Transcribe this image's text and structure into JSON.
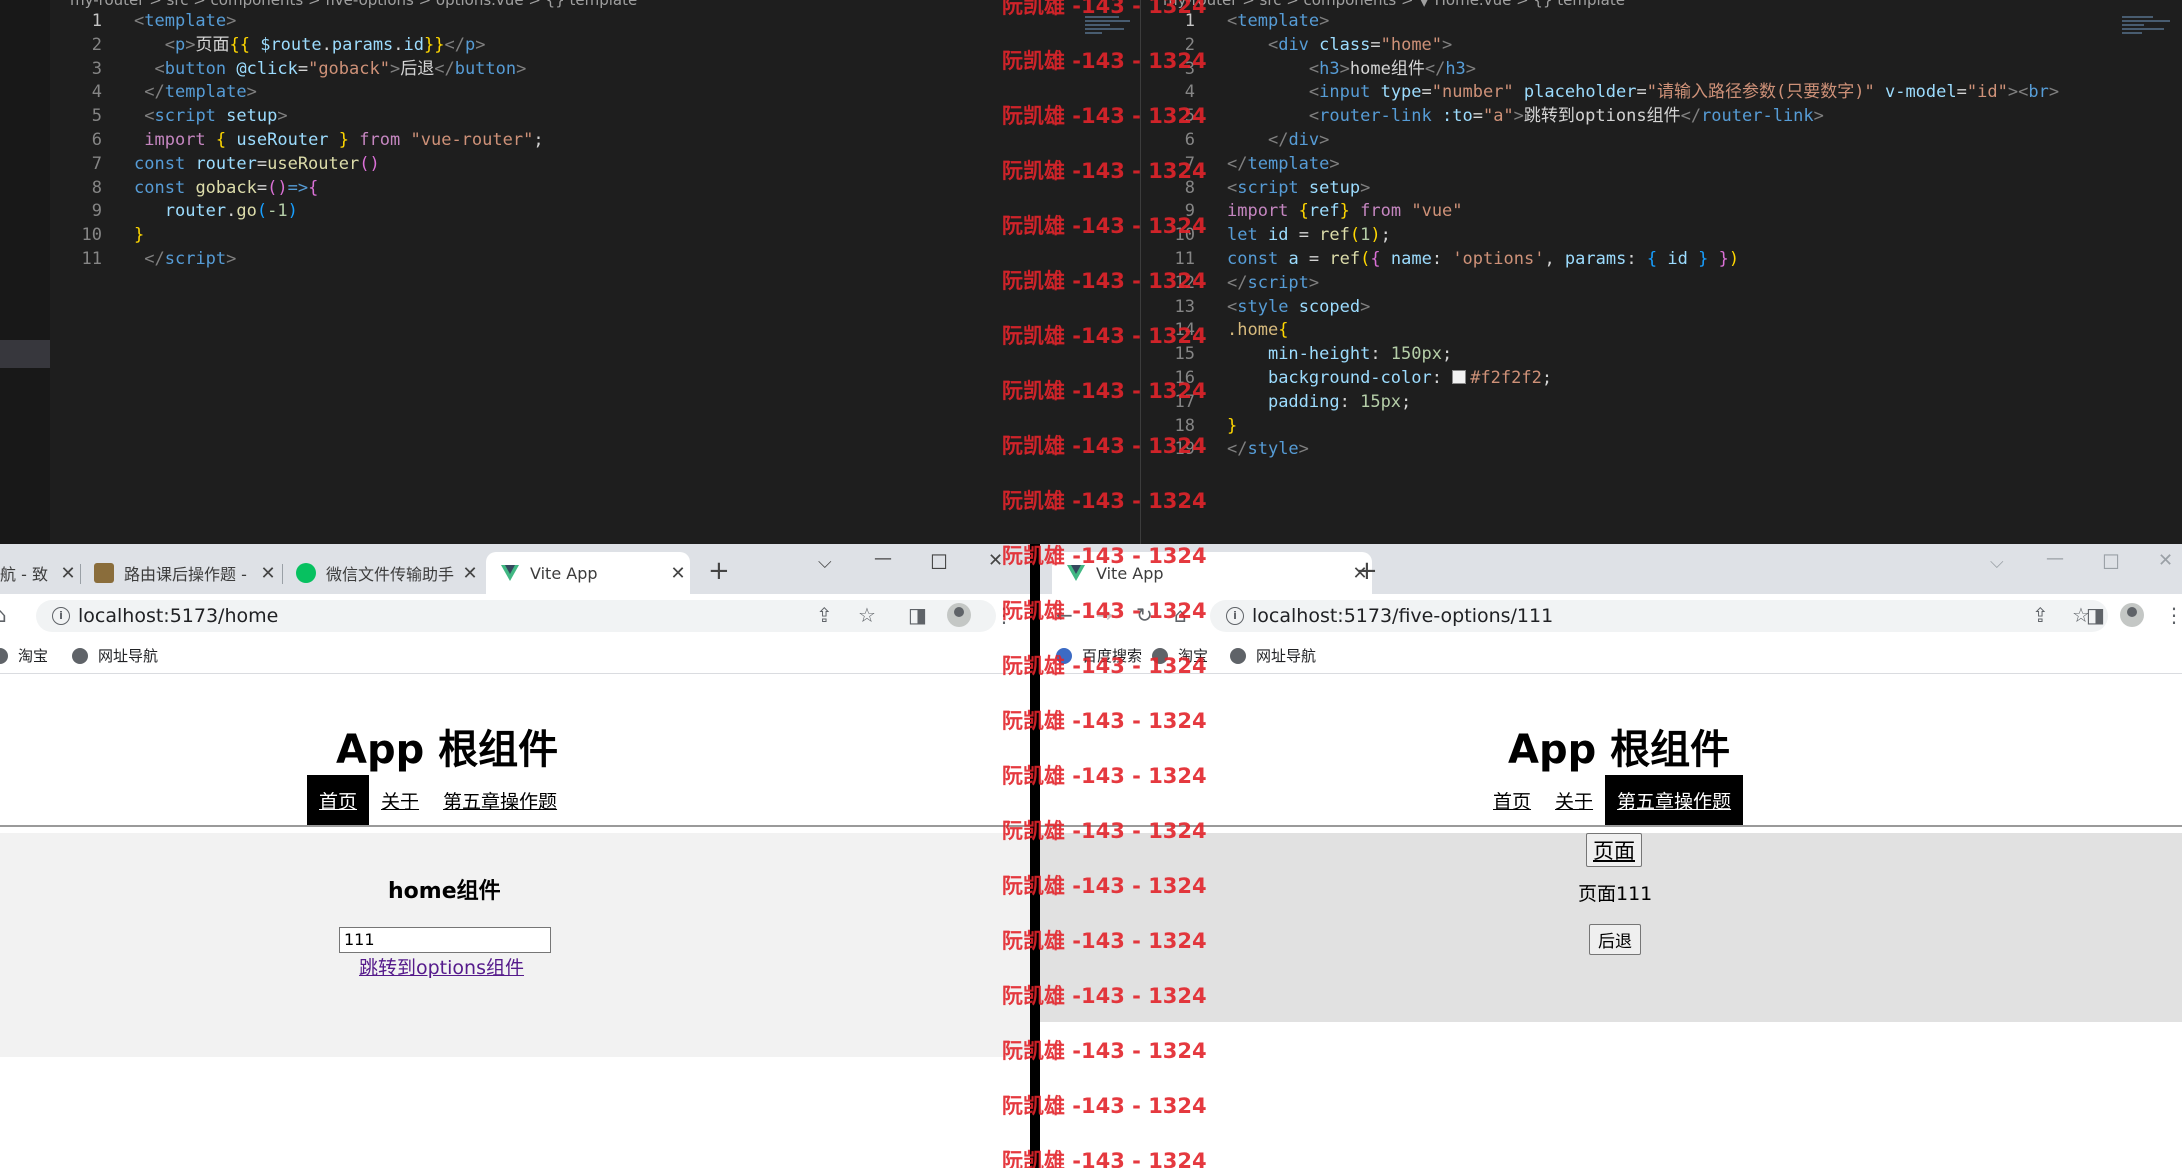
{
  "editor_left": {
    "breadcrumb": "my-router > src > components > five-options > options.vue > {} template",
    "lines": [
      {
        "n": "1",
        "tokens": [
          [
            "br",
            "<"
          ],
          [
            "tag",
            "template"
          ],
          [
            "br",
            ">"
          ]
        ]
      },
      {
        "n": "2",
        "tokens": [
          [
            "txt",
            "   "
          ],
          [
            "br",
            "<"
          ],
          [
            "tag",
            "p"
          ],
          [
            "br",
            ">"
          ],
          [
            "txt",
            "页面"
          ],
          [
            "brace",
            "{{"
          ],
          [
            "txt",
            " "
          ],
          [
            "var",
            "$route"
          ],
          [
            "txt",
            "."
          ],
          [
            "var",
            "params"
          ],
          [
            "txt",
            "."
          ],
          [
            "var",
            "id"
          ],
          [
            "brace",
            "}}"
          ],
          [
            "br",
            "</"
          ],
          [
            "tag",
            "p"
          ],
          [
            "br",
            ">"
          ]
        ]
      },
      {
        "n": "3",
        "tokens": [
          [
            "txt",
            "  "
          ],
          [
            "br",
            "<"
          ],
          [
            "tag",
            "button"
          ],
          [
            "txt",
            " "
          ],
          [
            "attr",
            "@click"
          ],
          [
            "txt",
            "="
          ],
          [
            "str",
            "\"goback\""
          ],
          [
            "br",
            ">"
          ],
          [
            "txt",
            "后退"
          ],
          [
            "br",
            "</"
          ],
          [
            "tag",
            "button"
          ],
          [
            "br",
            ">"
          ]
        ]
      },
      {
        "n": "4",
        "tokens": [
          [
            "txt",
            " "
          ],
          [
            "br",
            "</"
          ],
          [
            "tag",
            "template"
          ],
          [
            "br",
            ">"
          ]
        ]
      },
      {
        "n": "5",
        "tokens": [
          [
            "txt",
            " "
          ],
          [
            "br",
            "<"
          ],
          [
            "tag",
            "script"
          ],
          [
            "txt",
            " "
          ],
          [
            "attr",
            "setup"
          ],
          [
            "br",
            ">"
          ]
        ]
      },
      {
        "n": "6",
        "tokens": [
          [
            "txt",
            " "
          ],
          [
            "kw",
            "import"
          ],
          [
            "txt",
            " "
          ],
          [
            "brace",
            "{"
          ],
          [
            "txt",
            " "
          ],
          [
            "var",
            "useRouter"
          ],
          [
            "txt",
            " "
          ],
          [
            "brace",
            "}"
          ],
          [
            "txt",
            " "
          ],
          [
            "kw",
            "from"
          ],
          [
            "txt",
            " "
          ],
          [
            "str",
            "\"vue-router\""
          ],
          [
            "txt",
            ";"
          ]
        ]
      },
      {
        "n": "7",
        "tokens": [
          [
            "dec",
            "const"
          ],
          [
            "txt",
            " "
          ],
          [
            "var",
            "router"
          ],
          [
            "txt",
            "="
          ],
          [
            "fn",
            "useRouter"
          ],
          [
            "brace2",
            "()"
          ]
        ]
      },
      {
        "n": "8",
        "tokens": [
          [
            "dec",
            "const"
          ],
          [
            "txt",
            " "
          ],
          [
            "fn",
            "goback"
          ],
          [
            "txt",
            "="
          ],
          [
            "brace2",
            "()"
          ],
          [
            "dec",
            "=>"
          ],
          [
            "brace2",
            "{"
          ]
        ]
      },
      {
        "n": "9",
        "tokens": [
          [
            "txt",
            "   "
          ],
          [
            "var",
            "router"
          ],
          [
            "txt",
            "."
          ],
          [
            "fn",
            "go"
          ],
          [
            "brace3",
            "("
          ],
          [
            "num",
            "-1"
          ],
          [
            "brace3",
            ")"
          ]
        ]
      },
      {
        "n": "10",
        "tokens": [
          [
            "brace",
            "}"
          ]
        ]
      },
      {
        "n": "11",
        "tokens": [
          [
            "txt",
            " "
          ],
          [
            "br",
            "</"
          ],
          [
            "tag",
            "script"
          ],
          [
            "br",
            ">"
          ]
        ]
      }
    ]
  },
  "editor_right": {
    "breadcrumb": "my-router > src > components > ▼ Home.vue > {} template",
    "lines": [
      {
        "n": "1",
        "tokens": [
          [
            "br",
            "<"
          ],
          [
            "tag",
            "template"
          ],
          [
            "br",
            ">"
          ]
        ]
      },
      {
        "n": "2",
        "tokens": [
          [
            "txt",
            "    "
          ],
          [
            "br",
            "<"
          ],
          [
            "tag",
            "div"
          ],
          [
            "txt",
            " "
          ],
          [
            "attr",
            "class"
          ],
          [
            "txt",
            "="
          ],
          [
            "str",
            "\"home\""
          ],
          [
            "br",
            ">"
          ]
        ]
      },
      {
        "n": "3",
        "tokens": [
          [
            "txt",
            "        "
          ],
          [
            "br",
            "<"
          ],
          [
            "tag",
            "h3"
          ],
          [
            "br",
            ">"
          ],
          [
            "txt",
            "home组件"
          ],
          [
            "br",
            "</"
          ],
          [
            "tag",
            "h3"
          ],
          [
            "br",
            ">"
          ]
        ]
      },
      {
        "n": "4",
        "tokens": [
          [
            "txt",
            "        "
          ],
          [
            "br",
            "<"
          ],
          [
            "tag",
            "input"
          ],
          [
            "txt",
            " "
          ],
          [
            "attr",
            "type"
          ],
          [
            "txt",
            "="
          ],
          [
            "str",
            "\"number\""
          ],
          [
            "txt",
            " "
          ],
          [
            "attr",
            "placeholder"
          ],
          [
            "txt",
            "="
          ],
          [
            "str",
            "\"请输入路径参数(只要数字)\""
          ],
          [
            "txt",
            " "
          ],
          [
            "attr",
            "v-model"
          ],
          [
            "txt",
            "="
          ],
          [
            "str",
            "\"id\""
          ],
          [
            "br",
            ">"
          ],
          [
            "br",
            "<"
          ],
          [
            "tag",
            "br"
          ],
          [
            "br",
            ">"
          ]
        ]
      },
      {
        "n": "5",
        "tokens": [
          [
            "txt",
            "        "
          ],
          [
            "br",
            "<"
          ],
          [
            "tag",
            "router-link"
          ],
          [
            "txt",
            " "
          ],
          [
            "attr",
            ":to"
          ],
          [
            "txt",
            "="
          ],
          [
            "str",
            "\"a\""
          ],
          [
            "br",
            ">"
          ],
          [
            "txt",
            "跳转到options组件"
          ],
          [
            "br",
            "</"
          ],
          [
            "tag",
            "router-link"
          ],
          [
            "br",
            ">"
          ]
        ]
      },
      {
        "n": "6",
        "tokens": [
          [
            "txt",
            "    "
          ],
          [
            "br",
            "</"
          ],
          [
            "tag",
            "div"
          ],
          [
            "br",
            ">"
          ]
        ]
      },
      {
        "n": "7",
        "tokens": [
          [
            "br",
            "</"
          ],
          [
            "tag",
            "template"
          ],
          [
            "br",
            ">"
          ]
        ]
      },
      {
        "n": "8",
        "tokens": [
          [
            "br",
            "<"
          ],
          [
            "tag",
            "script"
          ],
          [
            "txt",
            " "
          ],
          [
            "attr",
            "setup"
          ],
          [
            "br",
            ">"
          ]
        ]
      },
      {
        "n": "9",
        "tokens": [
          [
            "kw",
            "import"
          ],
          [
            "txt",
            " "
          ],
          [
            "brace",
            "{"
          ],
          [
            "var",
            "ref"
          ],
          [
            "brace",
            "}"
          ],
          [
            "txt",
            " "
          ],
          [
            "kw",
            "from"
          ],
          [
            "txt",
            " "
          ],
          [
            "str",
            "\"vue\""
          ]
        ]
      },
      {
        "n": "10",
        "tokens": [
          [
            "dec",
            "let"
          ],
          [
            "txt",
            " "
          ],
          [
            "var",
            "id"
          ],
          [
            "txt",
            " = "
          ],
          [
            "fn",
            "ref"
          ],
          [
            "brace",
            "("
          ],
          [
            "num",
            "1"
          ],
          [
            "brace",
            ")"
          ],
          [
            "txt",
            ";"
          ]
        ]
      },
      {
        "n": "11",
        "tokens": [
          [
            "dec",
            "const"
          ],
          [
            "txt",
            " "
          ],
          [
            "var",
            "a"
          ],
          [
            "txt",
            " = "
          ],
          [
            "fn",
            "ref"
          ],
          [
            "brace",
            "("
          ],
          [
            "brace2",
            "{"
          ],
          [
            "txt",
            " "
          ],
          [
            "prop",
            "name"
          ],
          [
            "txt",
            ": "
          ],
          [
            "str",
            "'options'"
          ],
          [
            "txt",
            ", "
          ],
          [
            "prop",
            "params"
          ],
          [
            "txt",
            ": "
          ],
          [
            "brace3",
            "{"
          ],
          [
            "txt",
            " "
          ],
          [
            "var",
            "id"
          ],
          [
            "txt",
            " "
          ],
          [
            "brace3",
            "}"
          ],
          [
            "txt",
            " "
          ],
          [
            "brace2",
            "}"
          ],
          [
            "brace",
            ")"
          ]
        ]
      },
      {
        "n": "12",
        "tokens": [
          [
            "br",
            "</"
          ],
          [
            "tag",
            "script"
          ],
          [
            "br",
            ">"
          ]
        ]
      },
      {
        "n": "13",
        "tokens": [
          [
            "br",
            "<"
          ],
          [
            "tag",
            "style"
          ],
          [
            "txt",
            " "
          ],
          [
            "attr",
            "scoped"
          ],
          [
            "br",
            ">"
          ]
        ]
      },
      {
        "n": "14",
        "tokens": [
          [
            "sel",
            ".home"
          ],
          [
            "brace",
            "{"
          ]
        ]
      },
      {
        "n": "15",
        "tokens": [
          [
            "txt",
            "    "
          ],
          [
            "prop",
            "min-height"
          ],
          [
            "txt",
            ": "
          ],
          [
            "num",
            "150px"
          ],
          [
            "txt",
            ";"
          ]
        ]
      },
      {
        "n": "16",
        "tokens": [
          [
            "txt",
            "    "
          ],
          [
            "prop",
            "background-color"
          ],
          [
            "txt",
            ": "
          ],
          [
            "swatch",
            ""
          ],
          [
            "str",
            "#f2f2f2"
          ],
          [
            "txt",
            ";"
          ]
        ]
      },
      {
        "n": "17",
        "tokens": [
          [
            "txt",
            "    "
          ],
          [
            "prop",
            "padding"
          ],
          [
            "txt",
            ": "
          ],
          [
            "num",
            "15px"
          ],
          [
            "txt",
            ";"
          ]
        ]
      },
      {
        "n": "18",
        "tokens": [
          [
            "brace",
            "}"
          ]
        ]
      },
      {
        "n": "19",
        "tokens": [
          [
            "br",
            "</"
          ],
          [
            "tag",
            "style"
          ],
          [
            "br",
            ">"
          ]
        ]
      }
    ]
  },
  "browser_left": {
    "tabs": [
      "航 - 致",
      "路由课后操作题 -",
      "微信文件传输助手",
      "Vite App"
    ],
    "url": "localhost:5173/home",
    "bookmarks": [
      "淘宝",
      "网址导航"
    ],
    "app_title": "App 根组件",
    "nav": [
      "首页",
      "关于",
      "第五章操作题"
    ],
    "h3": "home组件",
    "input_value": "111",
    "link": "跳转到options组件"
  },
  "browser_right": {
    "tabs": [
      "Vite App"
    ],
    "url": "localhost:5173/five-options/111",
    "bookmarks": [
      "百度搜索",
      "淘宝",
      "网址导航"
    ],
    "app_title": "App 根组件",
    "nav": [
      "首页",
      "关于",
      "第五章操作题"
    ],
    "page_button": "页面",
    "page_text": "页面111",
    "back_button": "后退"
  },
  "watermark": "阮凯雄 -143 - 1324",
  "colors": {
    "editor_bg": "#1e1e1e",
    "nav_active_bg": "#000000",
    "panel_home_bg": "#f2f2f2",
    "panel_options_bg": "#e1e1e1",
    "watermark": "#e3242b",
    "link_visited": "#551a8b"
  }
}
